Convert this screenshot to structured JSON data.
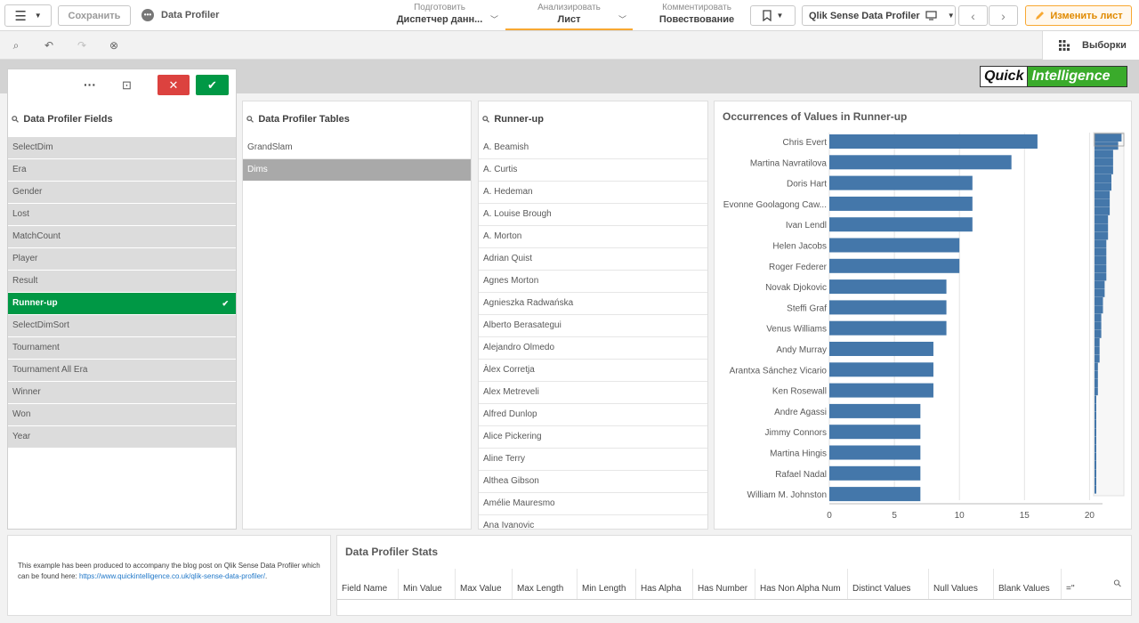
{
  "topbar": {
    "save_label": "Сохранить",
    "app_name": "Data Profiler",
    "tabs": [
      {
        "label": "Подготовить",
        "value": "Диспетчер данн..."
      },
      {
        "label": "Анализировать",
        "value": "Лист"
      },
      {
        "label": "Комментировать",
        "value": "Повествование"
      }
    ],
    "sheet_name": "Qlik Sense Data Profiler",
    "edit_label": "Изменить лист",
    "accent": "#f8a832"
  },
  "toolbar": {
    "selections_label": "Выборки"
  },
  "logo": {
    "part1": "Quick",
    "part2": "Intelligence"
  },
  "fields_panel": {
    "title": "Data Profiler Fields",
    "items": [
      "SelectDim",
      "Era",
      "Gender",
      "Lost",
      "MatchCount",
      "Player",
      "Result",
      "Runner-up",
      "SelectDimSort",
      "Tournament",
      "Tournament All Era",
      "Winner",
      "Won",
      "Year"
    ],
    "selected": "Runner-up"
  },
  "tables_panel": {
    "title": "Data Profiler Tables",
    "items": [
      "GrandSlam",
      "Dims"
    ],
    "alternative": "Dims"
  },
  "values_panel": {
    "title": "Runner-up",
    "items": [
      "A. Beamish",
      "A. Curtis",
      "A. Hedeman",
      "A. Louise Brough",
      "A. Morton",
      "Adrian Quist",
      "Agnes Morton",
      "Agnieszka Radwańska",
      "Alberto Berasategui",
      "Alejandro Olmedo",
      "Àlex Corretja",
      "Alex Metreveli",
      "Alfred Dunlop",
      "Alice Pickering",
      "Aline Terry",
      "Althea Gibson",
      "Amélie Mauresmo",
      "Ana Ivanovic"
    ]
  },
  "chart_data": {
    "type": "bar",
    "orientation": "horizontal",
    "title": "Occurrences of Values in Runner-up",
    "categories": [
      "Chris Evert",
      "Martina Navratilova",
      "Doris Hart",
      "Evonne Goolagong Caw...",
      "Ivan Lendl",
      "Helen Jacobs",
      "Roger Federer",
      "Novak Djokovic",
      "Steffi Graf",
      "Venus Williams",
      "Andy Murray",
      "Arantxa Sánchez Vicario",
      "Ken Rosewall",
      "Andre Agassi",
      "Jimmy Connors",
      "Martina Hingis",
      "Rafael Nadal",
      "William M. Johnston"
    ],
    "values": [
      16,
      14,
      11,
      11,
      11,
      10,
      10,
      9,
      9,
      9,
      8,
      8,
      8,
      7,
      7,
      7,
      7,
      7
    ],
    "xlim": [
      0,
      21
    ],
    "xticks": [
      "0",
      "5",
      "10",
      "15",
      "20"
    ],
    "grid": true,
    "bar_color": "#4477aa"
  },
  "notes": {
    "text": "This example has been produced to accompany the blog post on Qlik Sense Data Profiler which can be found here: ",
    "link": "https://www.quickintelligence.co.uk/qlik-sense-data-profiler/",
    "tail": "."
  },
  "stats_panel": {
    "title": "Data Profiler Stats",
    "columns": [
      "Field Name",
      "Min Value",
      "Max Value",
      "Max Length",
      "Min Length",
      "Has Alpha",
      "Has Number",
      "Has Non Alpha Num",
      "Distinct Values",
      "Null Values",
      "Blank Values",
      "=''"
    ]
  }
}
